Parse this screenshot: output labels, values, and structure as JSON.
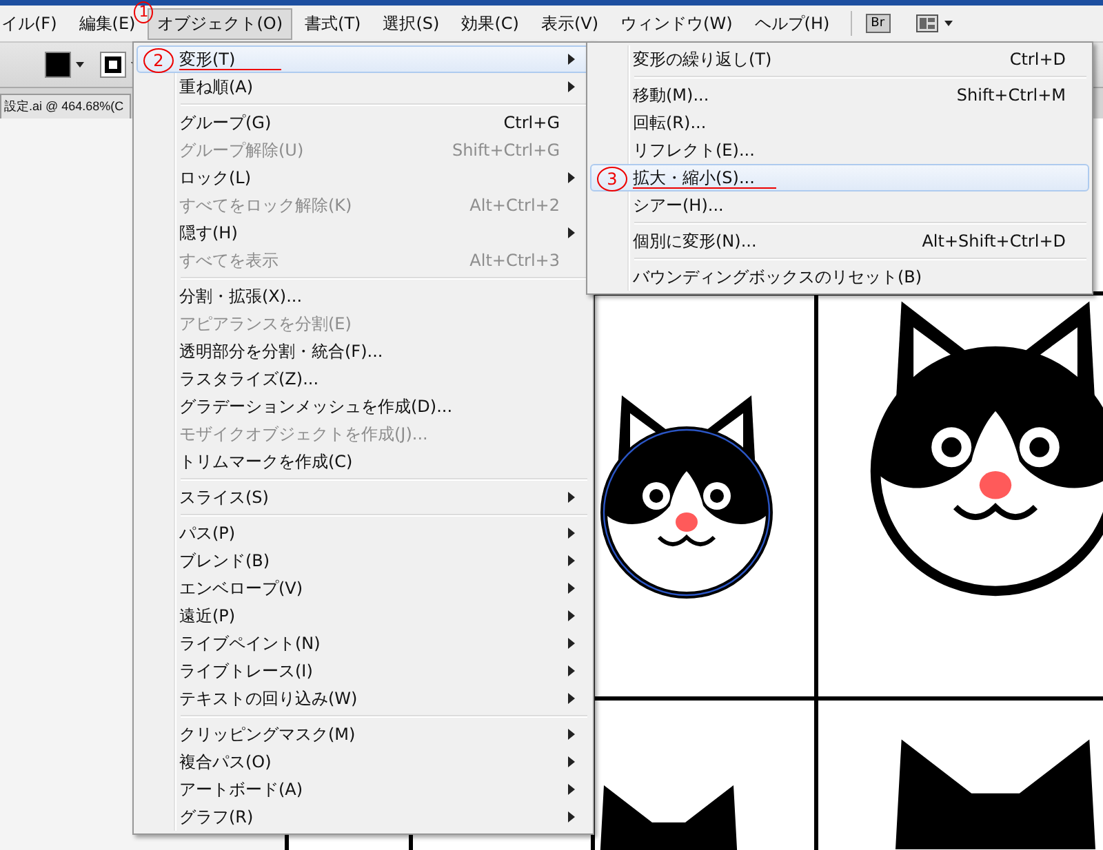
{
  "menubar": [
    {
      "label": "イル(F)",
      "selected": false
    },
    {
      "label": "編集(E)",
      "selected": false
    },
    {
      "label": "オブジェクト(O)",
      "selected": true,
      "note": "1"
    },
    {
      "label": "書式(T)",
      "selected": false
    },
    {
      "label": "選択(S)",
      "selected": false
    },
    {
      "label": "効果(C)",
      "selected": false
    },
    {
      "label": "表示(V)",
      "selected": false
    },
    {
      "label": "ウィンドウ(W)",
      "selected": false
    },
    {
      "label": "ヘルプ(H)",
      "selected": false
    }
  ],
  "bridge_button": {
    "label": "Br"
  },
  "document_tab": {
    "title": "設定.ai @ 464.68%(C"
  },
  "object_menu": [
    {
      "kind": "item",
      "label": "変形(T)",
      "submenu": true,
      "disabled": false,
      "selected": true,
      "note": "2"
    },
    {
      "kind": "item",
      "label": "重ね順(A)",
      "submenu": true,
      "disabled": false,
      "selected": false
    },
    {
      "kind": "separator"
    },
    {
      "kind": "item",
      "label": "グループ(G)",
      "shortcut": "Ctrl+G",
      "submenu": false,
      "disabled": false,
      "selected": false
    },
    {
      "kind": "item",
      "label": "グループ解除(U)",
      "shortcut": "Shift+Ctrl+G",
      "submenu": false,
      "disabled": true,
      "selected": false
    },
    {
      "kind": "item",
      "label": "ロック(L)",
      "submenu": true,
      "disabled": false,
      "selected": false
    },
    {
      "kind": "item",
      "label": "すべてをロック解除(K)",
      "shortcut": "Alt+Ctrl+2",
      "submenu": false,
      "disabled": true,
      "selected": false
    },
    {
      "kind": "item",
      "label": "隠す(H)",
      "submenu": true,
      "disabled": false,
      "selected": false
    },
    {
      "kind": "item",
      "label": "すべてを表示",
      "shortcut": "Alt+Ctrl+3",
      "submenu": false,
      "disabled": true,
      "selected": false
    },
    {
      "kind": "separator"
    },
    {
      "kind": "item",
      "label": "分割・拡張(X)...",
      "submenu": false,
      "disabled": false,
      "selected": false
    },
    {
      "kind": "item",
      "label": "アピアランスを分割(E)",
      "submenu": false,
      "disabled": true,
      "selected": false
    },
    {
      "kind": "item",
      "label": "透明部分を分割・統合(F)...",
      "submenu": false,
      "disabled": false,
      "selected": false
    },
    {
      "kind": "item",
      "label": "ラスタライズ(Z)...",
      "submenu": false,
      "disabled": false,
      "selected": false
    },
    {
      "kind": "item",
      "label": "グラデーションメッシュを作成(D)...",
      "submenu": false,
      "disabled": false,
      "selected": false
    },
    {
      "kind": "item",
      "label": "モザイクオブジェクトを作成(J)...",
      "submenu": false,
      "disabled": true,
      "selected": false
    },
    {
      "kind": "item",
      "label": "トリムマークを作成(C)",
      "submenu": false,
      "disabled": false,
      "selected": false
    },
    {
      "kind": "separator"
    },
    {
      "kind": "item",
      "label": "スライス(S)",
      "submenu": true,
      "disabled": false,
      "selected": false
    },
    {
      "kind": "separator"
    },
    {
      "kind": "item",
      "label": "パス(P)",
      "submenu": true,
      "disabled": false,
      "selected": false
    },
    {
      "kind": "item",
      "label": "ブレンド(B)",
      "submenu": true,
      "disabled": false,
      "selected": false
    },
    {
      "kind": "item",
      "label": "エンベロープ(V)",
      "submenu": true,
      "disabled": false,
      "selected": false
    },
    {
      "kind": "item",
      "label": "遠近(P)",
      "submenu": true,
      "disabled": false,
      "selected": false
    },
    {
      "kind": "item",
      "label": "ライブペイント(N)",
      "submenu": true,
      "disabled": false,
      "selected": false
    },
    {
      "kind": "item",
      "label": "ライブトレース(I)",
      "submenu": true,
      "disabled": false,
      "selected": false
    },
    {
      "kind": "item",
      "label": "テキストの回り込み(W)",
      "submenu": true,
      "disabled": false,
      "selected": false
    },
    {
      "kind": "separator"
    },
    {
      "kind": "item",
      "label": "クリッピングマスク(M)",
      "submenu": true,
      "disabled": false,
      "selected": false
    },
    {
      "kind": "item",
      "label": "複合パス(O)",
      "submenu": true,
      "disabled": false,
      "selected": false
    },
    {
      "kind": "item",
      "label": "アートボード(A)",
      "submenu": true,
      "disabled": false,
      "selected": false
    },
    {
      "kind": "item",
      "label": "グラフ(R)",
      "submenu": true,
      "disabled": false,
      "selected": false
    }
  ],
  "transform_submenu": [
    {
      "kind": "item",
      "label": "変形の繰り返し(T)",
      "shortcut": "Ctrl+D",
      "selected": false
    },
    {
      "kind": "separator"
    },
    {
      "kind": "item",
      "label": "移動(M)...",
      "shortcut": "Shift+Ctrl+M",
      "selected": false
    },
    {
      "kind": "item",
      "label": "回転(R)...",
      "selected": false
    },
    {
      "kind": "item",
      "label": "リフレクト(E)...",
      "selected": false
    },
    {
      "kind": "item",
      "label": "拡大・縮小(S)...",
      "selected": true,
      "note": "3"
    },
    {
      "kind": "item",
      "label": "シアー(H)...",
      "selected": false
    },
    {
      "kind": "separator"
    },
    {
      "kind": "item",
      "label": "個別に変形(N)...",
      "shortcut": "Alt+Shift+Ctrl+D",
      "selected": false
    },
    {
      "kind": "separator"
    },
    {
      "kind": "item",
      "label": "バウンディングボックスのリセット(B)",
      "selected": false
    }
  ]
}
